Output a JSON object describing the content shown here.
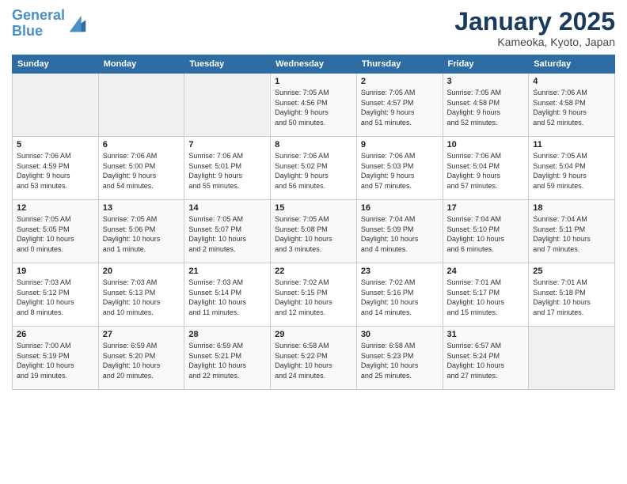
{
  "header": {
    "logo_line1": "General",
    "logo_line2": "Blue",
    "title": "January 2025",
    "subtitle": "Kameoka, Kyoto, Japan"
  },
  "columns": [
    "Sunday",
    "Monday",
    "Tuesday",
    "Wednesday",
    "Thursday",
    "Friday",
    "Saturday"
  ],
  "weeks": [
    [
      {
        "day": "",
        "info": ""
      },
      {
        "day": "",
        "info": ""
      },
      {
        "day": "",
        "info": ""
      },
      {
        "day": "1",
        "info": "Sunrise: 7:05 AM\nSunset: 4:56 PM\nDaylight: 9 hours\nand 50 minutes."
      },
      {
        "day": "2",
        "info": "Sunrise: 7:05 AM\nSunset: 4:57 PM\nDaylight: 9 hours\nand 51 minutes."
      },
      {
        "day": "3",
        "info": "Sunrise: 7:05 AM\nSunset: 4:58 PM\nDaylight: 9 hours\nand 52 minutes."
      },
      {
        "day": "4",
        "info": "Sunrise: 7:06 AM\nSunset: 4:58 PM\nDaylight: 9 hours\nand 52 minutes."
      }
    ],
    [
      {
        "day": "5",
        "info": "Sunrise: 7:06 AM\nSunset: 4:59 PM\nDaylight: 9 hours\nand 53 minutes."
      },
      {
        "day": "6",
        "info": "Sunrise: 7:06 AM\nSunset: 5:00 PM\nDaylight: 9 hours\nand 54 minutes."
      },
      {
        "day": "7",
        "info": "Sunrise: 7:06 AM\nSunset: 5:01 PM\nDaylight: 9 hours\nand 55 minutes."
      },
      {
        "day": "8",
        "info": "Sunrise: 7:06 AM\nSunset: 5:02 PM\nDaylight: 9 hours\nand 56 minutes."
      },
      {
        "day": "9",
        "info": "Sunrise: 7:06 AM\nSunset: 5:03 PM\nDaylight: 9 hours\nand 57 minutes."
      },
      {
        "day": "10",
        "info": "Sunrise: 7:06 AM\nSunset: 5:04 PM\nDaylight: 9 hours\nand 57 minutes."
      },
      {
        "day": "11",
        "info": "Sunrise: 7:05 AM\nSunset: 5:04 PM\nDaylight: 9 hours\nand 59 minutes."
      }
    ],
    [
      {
        "day": "12",
        "info": "Sunrise: 7:05 AM\nSunset: 5:05 PM\nDaylight: 10 hours\nand 0 minutes."
      },
      {
        "day": "13",
        "info": "Sunrise: 7:05 AM\nSunset: 5:06 PM\nDaylight: 10 hours\nand 1 minute."
      },
      {
        "day": "14",
        "info": "Sunrise: 7:05 AM\nSunset: 5:07 PM\nDaylight: 10 hours\nand 2 minutes."
      },
      {
        "day": "15",
        "info": "Sunrise: 7:05 AM\nSunset: 5:08 PM\nDaylight: 10 hours\nand 3 minutes."
      },
      {
        "day": "16",
        "info": "Sunrise: 7:04 AM\nSunset: 5:09 PM\nDaylight: 10 hours\nand 4 minutes."
      },
      {
        "day": "17",
        "info": "Sunrise: 7:04 AM\nSunset: 5:10 PM\nDaylight: 10 hours\nand 6 minutes."
      },
      {
        "day": "18",
        "info": "Sunrise: 7:04 AM\nSunset: 5:11 PM\nDaylight: 10 hours\nand 7 minutes."
      }
    ],
    [
      {
        "day": "19",
        "info": "Sunrise: 7:03 AM\nSunset: 5:12 PM\nDaylight: 10 hours\nand 8 minutes."
      },
      {
        "day": "20",
        "info": "Sunrise: 7:03 AM\nSunset: 5:13 PM\nDaylight: 10 hours\nand 10 minutes."
      },
      {
        "day": "21",
        "info": "Sunrise: 7:03 AM\nSunset: 5:14 PM\nDaylight: 10 hours\nand 11 minutes."
      },
      {
        "day": "22",
        "info": "Sunrise: 7:02 AM\nSunset: 5:15 PM\nDaylight: 10 hours\nand 12 minutes."
      },
      {
        "day": "23",
        "info": "Sunrise: 7:02 AM\nSunset: 5:16 PM\nDaylight: 10 hours\nand 14 minutes."
      },
      {
        "day": "24",
        "info": "Sunrise: 7:01 AM\nSunset: 5:17 PM\nDaylight: 10 hours\nand 15 minutes."
      },
      {
        "day": "25",
        "info": "Sunrise: 7:01 AM\nSunset: 5:18 PM\nDaylight: 10 hours\nand 17 minutes."
      }
    ],
    [
      {
        "day": "26",
        "info": "Sunrise: 7:00 AM\nSunset: 5:19 PM\nDaylight: 10 hours\nand 19 minutes."
      },
      {
        "day": "27",
        "info": "Sunrise: 6:59 AM\nSunset: 5:20 PM\nDaylight: 10 hours\nand 20 minutes."
      },
      {
        "day": "28",
        "info": "Sunrise: 6:59 AM\nSunset: 5:21 PM\nDaylight: 10 hours\nand 22 minutes."
      },
      {
        "day": "29",
        "info": "Sunrise: 6:58 AM\nSunset: 5:22 PM\nDaylight: 10 hours\nand 24 minutes."
      },
      {
        "day": "30",
        "info": "Sunrise: 6:58 AM\nSunset: 5:23 PM\nDaylight: 10 hours\nand 25 minutes."
      },
      {
        "day": "31",
        "info": "Sunrise: 6:57 AM\nSunset: 5:24 PM\nDaylight: 10 hours\nand 27 minutes."
      },
      {
        "day": "",
        "info": ""
      }
    ]
  ]
}
